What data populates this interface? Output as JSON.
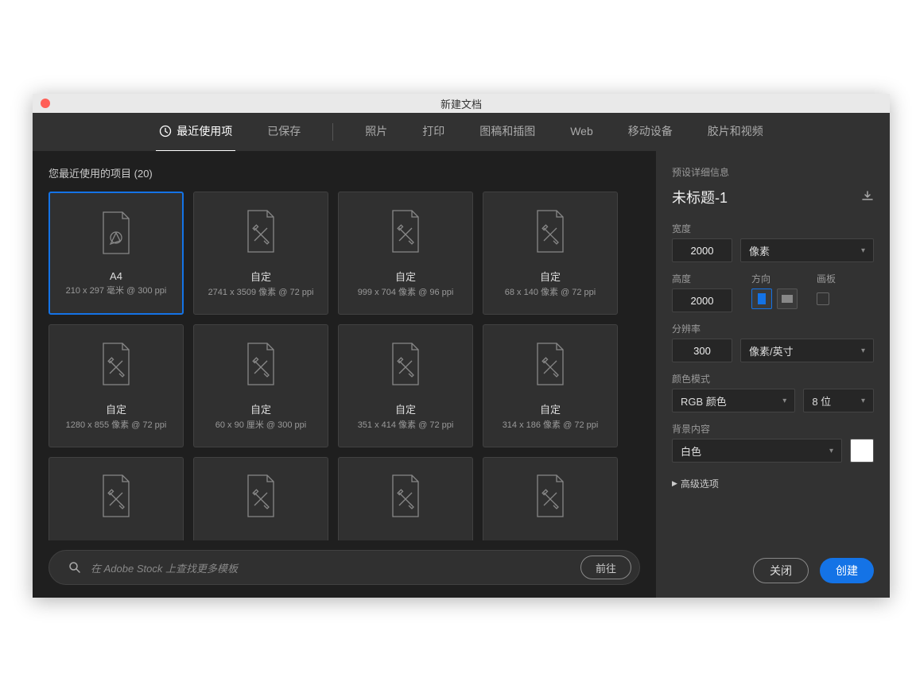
{
  "window": {
    "title": "新建文档"
  },
  "tabs": {
    "recent": "最近使用项",
    "saved": "已保存",
    "photo": "照片",
    "print": "打印",
    "artwork": "图稿和插图",
    "web": "Web",
    "mobile": "移动设备",
    "film": "胶片和视频"
  },
  "recent": {
    "label": "您最近使用的项目",
    "count": "(20)",
    "items": [
      {
        "name": "A4",
        "meta": "210 x 297 毫米 @ 300 ppi",
        "type": "a4"
      },
      {
        "name": "自定",
        "meta": "2741 x 3509 像素 @ 72 ppi",
        "type": "custom"
      },
      {
        "name": "自定",
        "meta": "999 x 704 像素 @ 96 ppi",
        "type": "custom"
      },
      {
        "name": "自定",
        "meta": "68 x 140 像素 @ 72 ppi",
        "type": "custom"
      },
      {
        "name": "自定",
        "meta": "1280 x 855 像素 @ 72 ppi",
        "type": "custom"
      },
      {
        "name": "自定",
        "meta": "60 x 90 厘米 @ 300 ppi",
        "type": "custom"
      },
      {
        "name": "自定",
        "meta": "351 x 414 像素 @ 72 ppi",
        "type": "custom"
      },
      {
        "name": "自定",
        "meta": "314 x 186 像素 @ 72 ppi",
        "type": "custom"
      },
      {
        "name": "",
        "meta": "",
        "type": "custom"
      },
      {
        "name": "",
        "meta": "",
        "type": "custom"
      },
      {
        "name": "",
        "meta": "",
        "type": "custom"
      },
      {
        "name": "",
        "meta": "",
        "type": "custom"
      }
    ]
  },
  "search": {
    "placeholder": "在 Adobe Stock 上查找更多模板",
    "go": "前往"
  },
  "details": {
    "header": "预设详细信息",
    "doc_name": "未标题-1",
    "width_label": "宽度",
    "width_value": "2000",
    "unit": "像素",
    "height_label": "高度",
    "height_value": "2000",
    "orientation_label": "方向",
    "artboard_label": "画板",
    "resolution_label": "分辨率",
    "resolution_value": "300",
    "resolution_unit": "像素/英寸",
    "color_mode_label": "颜色模式",
    "color_mode": "RGB 颜色",
    "bit_depth": "8 位",
    "background_label": "背景内容",
    "background": "白色",
    "advanced": "高级选项"
  },
  "actions": {
    "close": "关闭",
    "create": "创建"
  }
}
